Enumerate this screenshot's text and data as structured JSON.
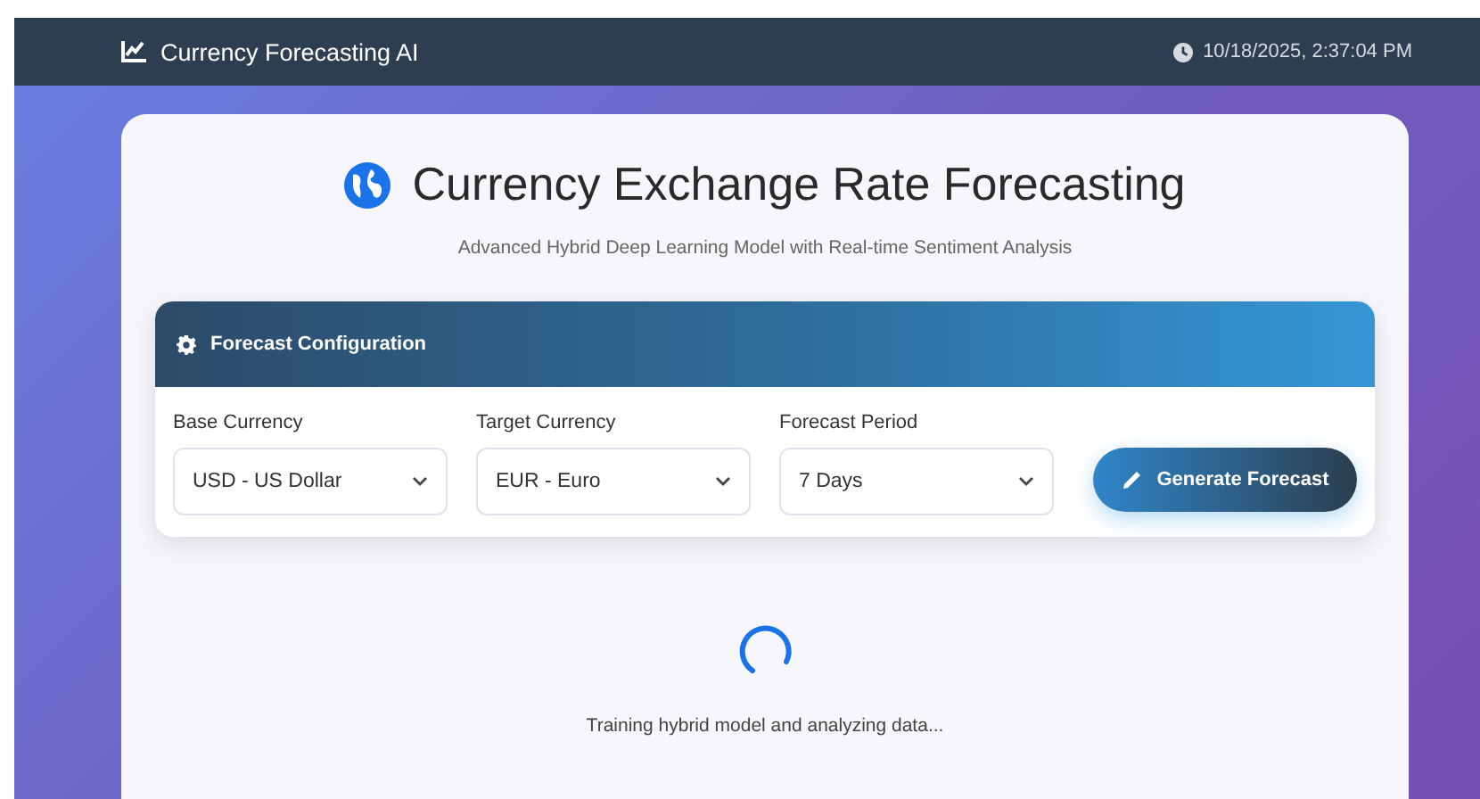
{
  "navbar": {
    "brand": "Currency Forecasting AI",
    "datetime": "10/18/2025, 2:37:04 PM"
  },
  "header": {
    "title": "Currency Exchange Rate Forecasting",
    "subtitle": "Advanced Hybrid Deep Learning Model with Real-time Sentiment Analysis"
  },
  "config": {
    "title": "Forecast Configuration",
    "fields": [
      {
        "label": "Base Currency",
        "value": "USD - US Dollar"
      },
      {
        "label": "Target Currency",
        "value": "EUR - Euro"
      },
      {
        "label": "Forecast Period",
        "value": "7 Days"
      }
    ],
    "button": "Generate Forecast"
  },
  "loading": {
    "message": "Training hybrid model and analyzing data..."
  }
}
